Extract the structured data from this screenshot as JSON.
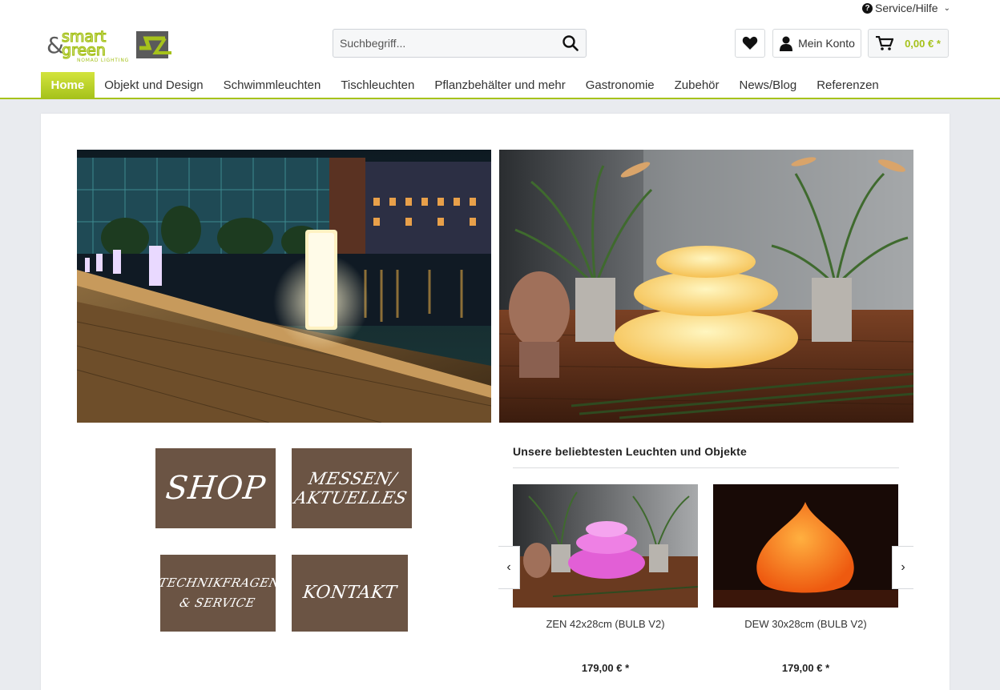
{
  "header": {
    "service_label": "Service/Hilfe",
    "logo": {
      "line1": "smart",
      "line2": "green",
      "ampersand": "&",
      "tagline": "NOMAD LIGHTING",
      "brand_color": "#a6c21b"
    },
    "search": {
      "placeholder": "Suchbegriff..."
    },
    "account_label": "Mein Konto",
    "cart_amount": "0,00 € *"
  },
  "nav": {
    "items": [
      {
        "label": "Home",
        "active": true
      },
      {
        "label": "Objekt und Design"
      },
      {
        "label": "Schwimmleuchten"
      },
      {
        "label": "Tischleuchten"
      },
      {
        "label": "Pflanzbehälter und mehr"
      },
      {
        "label": "Gastronomie"
      },
      {
        "label": "Zubehör"
      },
      {
        "label": "News/Blog"
      },
      {
        "label": "Referenzen"
      }
    ]
  },
  "tiles": {
    "shop": "SHOP",
    "messen_line1": "MESSEN/",
    "messen_line2": "AKTUELLES",
    "tech_line1": "TECHNIKFRAGEN",
    "tech_line2": "& SERVICE",
    "kontakt": "KONTAKT"
  },
  "popular": {
    "title": "Unsere beliebtesten Leuchten und Objekte",
    "products": [
      {
        "name": "ZEN 42x28cm (BULB V2)",
        "price": "179,00 € *"
      },
      {
        "name": "DEW 30x28cm (BULB V2)",
        "price": "179,00 € *"
      }
    ]
  },
  "colors": {
    "accent": "#a6c21b",
    "tile_brown": "#6b5444",
    "background": "#e9ebef"
  },
  "icons": {
    "service": "question-circle-icon",
    "search": "magnifier-icon",
    "wishlist": "heart-icon",
    "account": "user-icon",
    "cart": "cart-icon",
    "prev": "chevron-left-icon",
    "next": "chevron-right-icon"
  }
}
